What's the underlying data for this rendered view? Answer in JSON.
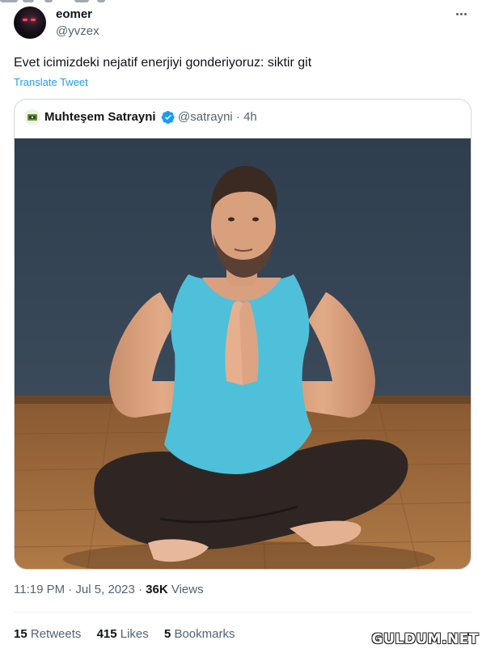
{
  "tweet": {
    "author_name": "eomer",
    "author_handle": "@yvzex",
    "text": "Evet icimizdeki nejatif enerjiyi gonderiyoruz: siktir git",
    "translate_label": "Translate Tweet",
    "timestamp": "11:19 PM · Jul 5, 2023 · ",
    "views_count": "36K",
    "views_label": " Views",
    "retweets_count": "15",
    "retweets_label": " Retweets",
    "likes_count": "415",
    "likes_label": " Likes",
    "bookmarks_count": "5",
    "bookmarks_label": " Bookmarks"
  },
  "quoted": {
    "author_name": "Muhteşem Satrayni",
    "author_handle": "@satrayni · 4h",
    "verified": true
  },
  "icons": {
    "more": "more-dots-icon",
    "verified": "verified-badge-icon"
  },
  "colors": {
    "link": "#1d9bf0",
    "secondary_text": "#536471",
    "border": "#cfd9de"
  },
  "watermark": "GULDUM.NET"
}
